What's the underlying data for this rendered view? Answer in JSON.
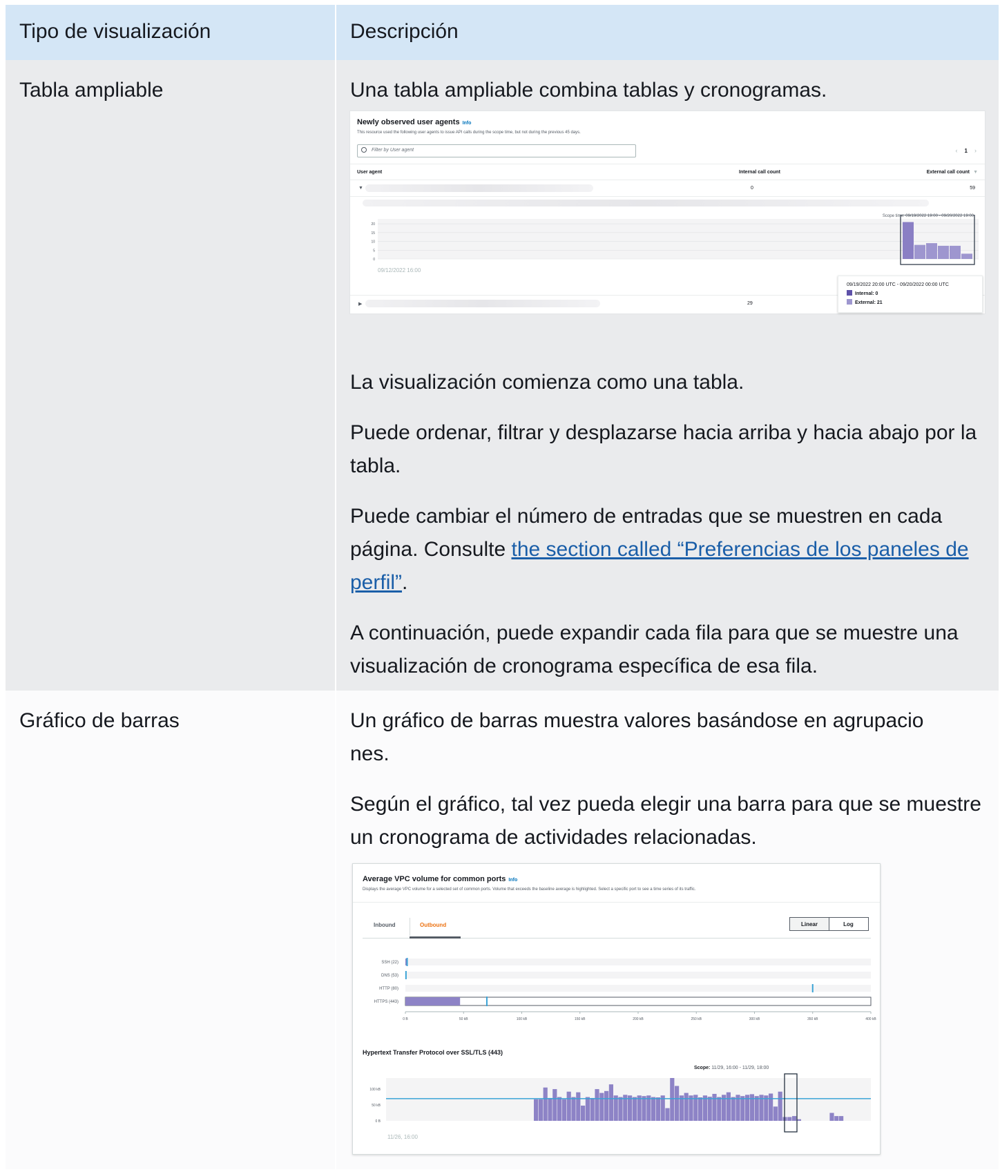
{
  "table": {
    "headers": [
      "Tipo de visualización",
      "Descripción"
    ],
    "row1": {
      "type": "Tabla ampliable",
      "intro": "Una tabla ampliable combina tablas y cronogramas.",
      "p1": "La visualización comienza como una tabla.",
      "p2": "Puede ordenar, filtrar y desplazarse hacia arriba y hacia abajo por la tabla.",
      "p3_before": "Puede cambiar el número de entradas que se muestren en cada página. Consulte ",
      "p3_link": "the section called “Preferencias de los paneles de perfil”",
      "p3_after": ".",
      "p4": "A continuación, puede expandir cada fila para que se muestre una visualización de cronograma específica de esa fila."
    },
    "row2": {
      "type": "Gráfico de barras",
      "p1": "Un gráfico de barras muestra valores basándose en agrupacio nes.",
      "p2": "Según el gráfico, tal vez pueda elegir una barra para que se muestre un cronograma de actividades relacionadas."
    }
  },
  "figure1": {
    "title": "Newly observed user agents",
    "info": "Info",
    "description": "This resource used the following user agents to issue API calls during the scope time, but not during the previous 45 days.",
    "filter_placeholder": "Filter by User agent",
    "page": "1",
    "columns": [
      "User agent",
      "Internal call count",
      "External call count"
    ],
    "rows": [
      {
        "internal": "0",
        "external": "59"
      },
      {
        "internal": "29",
        "external": ""
      }
    ],
    "scope_time": "Scope time: 09/19/2022 19:00 - 09/20/2022 19:00",
    "x_label": "09/12/2022 16:00",
    "tooltip": {
      "range": "09/19/2022 20:00 UTC - 09/20/2022 00:00 UTC",
      "internal": "Internal: 0",
      "external": "External: 21"
    },
    "chart_data": {
      "type": "bar",
      "yticks": [
        "20",
        "15",
        "10",
        "5",
        "0"
      ],
      "ylim": [
        0,
        22
      ],
      "values": [
        21,
        8,
        9,
        7.5,
        7.5,
        3
      ],
      "color": "#8d83c6"
    }
  },
  "figure2": {
    "title": "Average VPC volume for common ports",
    "info": "Info",
    "description": "Displays the average VPC volume for a selected set of common ports. Volume that exceeds the baseline average is highlighted. Select a specific port to see a time series of its traffic.",
    "tabs": [
      "Inbound",
      "Outbound"
    ],
    "scale_options": [
      "Linear",
      "Log"
    ],
    "ports_chart": {
      "type": "bar",
      "categories": [
        "SSH (22)",
        "DNS (53)",
        "HTTP (80)",
        "HTTPS (443)"
      ],
      "values_kb": [
        1,
        0,
        0,
        47
      ],
      "baseline_kb": [
        1.5,
        0.5,
        350,
        70
      ],
      "xticks": [
        "0 B",
        "50 kB",
        "100 kB",
        "150 kB",
        "200 kB",
        "250 kB",
        "300 kB",
        "350 kB",
        "400 kB"
      ],
      "xlim_kb": [
        0,
        400
      ]
    },
    "subtitle": "Hypertext Transfer Protocol over SSL/TLS (443)",
    "scope_label": "Scope:",
    "scope_value": "11/29, 16:00 - 11/29, 18:00",
    "x_label": "11/26, 16:00",
    "timeseries": {
      "type": "bar",
      "yticks": [
        "100 kB",
        "50 kB",
        "0 B"
      ],
      "baseline_kb": 70,
      "values_kb": [
        68,
        68,
        105,
        72,
        100,
        75,
        68,
        92,
        75,
        90,
        48,
        75,
        72,
        100,
        88,
        94,
        115,
        80,
        75,
        82,
        80,
        75,
        80,
        78,
        80,
        75,
        74,
        80,
        40,
        135,
        110,
        80,
        88,
        80,
        82,
        74,
        80,
        76,
        85,
        75,
        82,
        90,
        75,
        82,
        78,
        82,
        84,
        78,
        82,
        80,
        86,
        45,
        92,
        12,
        12,
        15,
        5,
        0,
        0,
        0,
        0,
        0,
        0,
        25,
        15,
        15
      ]
    }
  }
}
